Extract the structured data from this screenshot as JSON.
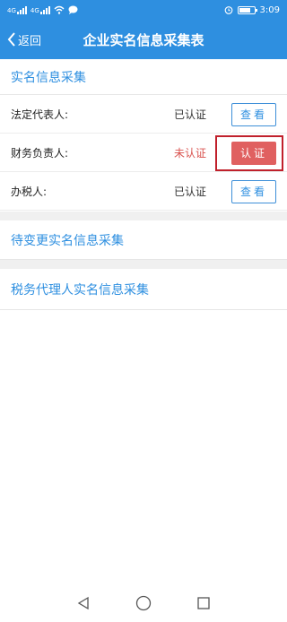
{
  "status_bar": {
    "time": "3:09",
    "battery_level": 0.75
  },
  "header": {
    "back_label": "返回",
    "title": "企业实名信息采集表"
  },
  "section_realname": {
    "title": "实名信息采集",
    "rows": [
      {
        "label": "法定代表人:",
        "status": "已认证",
        "action": "查看"
      },
      {
        "label": "财务负责人:",
        "status": "未认证",
        "action": "认证"
      },
      {
        "label": "办税人:",
        "status": "已认证",
        "action": "查看"
      }
    ]
  },
  "section_pending": {
    "title": "待变更实名信息采集"
  },
  "section_agent": {
    "title": "税务代理人实名信息采集"
  },
  "system_nav": {
    "back_icon": "triangle-back-icon",
    "home_icon": "circle-home-icon",
    "recents_icon": "square-recents-icon"
  }
}
